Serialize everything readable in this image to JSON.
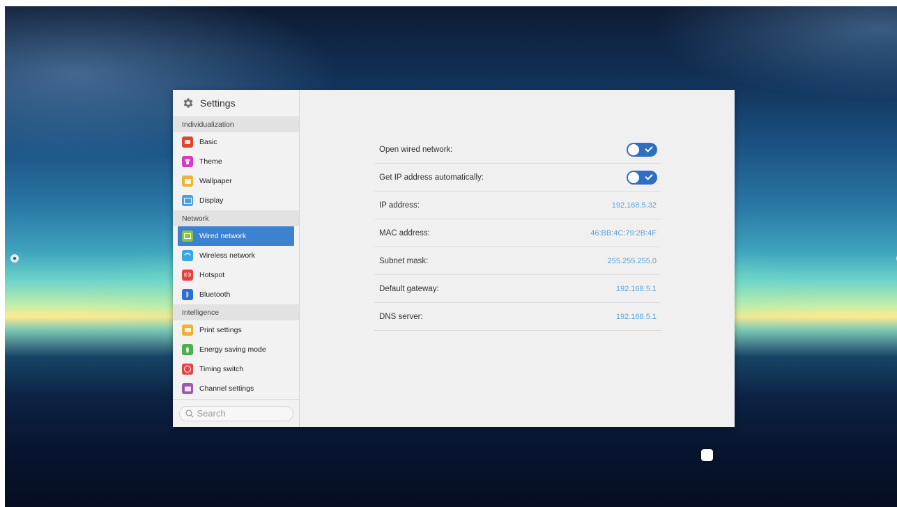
{
  "sidebar": {
    "title": "Settings",
    "groups": [
      {
        "header": "Individualization",
        "items": [
          {
            "label": "Basic",
            "icon": "basic-icon",
            "color": "#e2452c"
          },
          {
            "label": "Theme",
            "icon": "theme-icon",
            "color": "#d63cbf"
          },
          {
            "label": "Wallpaper",
            "icon": "wallpaper-icon",
            "color": "#e9b53a"
          },
          {
            "label": "Display",
            "icon": "display-icon",
            "color": "#4a9ee3"
          }
        ]
      },
      {
        "header": "Network",
        "items": [
          {
            "label": "Wired network",
            "icon": "wired-network-icon",
            "color": "#8cc63f",
            "selected": true
          },
          {
            "label": "Wireless network",
            "icon": "wifi-icon",
            "color": "#3aa7e0"
          },
          {
            "label": "Hotspot",
            "icon": "hotspot-icon",
            "color": "#e64040"
          },
          {
            "label": "Bluetooth",
            "icon": "bluetooth-icon",
            "color": "#2e6fd1"
          }
        ]
      },
      {
        "header": "Intelligence",
        "items": [
          {
            "label": "Print settings",
            "icon": "print-icon",
            "color": "#eab236"
          },
          {
            "label": "Energy saving mode",
            "icon": "leaf-icon",
            "color": "#4caf50"
          },
          {
            "label": "Timing switch",
            "icon": "clock-icon",
            "color": "#e3454a"
          },
          {
            "label": "Channel settings",
            "icon": "channel-icon",
            "color": "#9b59b6"
          }
        ]
      }
    ],
    "search": {
      "placeholder": "Search",
      "value": ""
    }
  },
  "wired": {
    "open_wired_network": {
      "label": "Open wired network:",
      "on": true
    },
    "get_ip_auto": {
      "label": "Get IP address automatically:",
      "on": true
    },
    "ip_address": {
      "label": "IP address:",
      "value": "192.168.5.32"
    },
    "mac_address": {
      "label": "MAC address:",
      "value": "46:BB:4C:79:2B:4F"
    },
    "subnet_mask": {
      "label": "Subnet mask:",
      "value": "255.255.255.0"
    },
    "default_gateway": {
      "label": "Default gateway:",
      "value": "192.168.5.1"
    },
    "dns_server": {
      "label": "DNS server:",
      "value": "192.168.5.1"
    }
  },
  "colors": {
    "accent": "#3c82d0",
    "toggle_on": "#2f6fc1",
    "value_text": "#5aa4d8"
  }
}
